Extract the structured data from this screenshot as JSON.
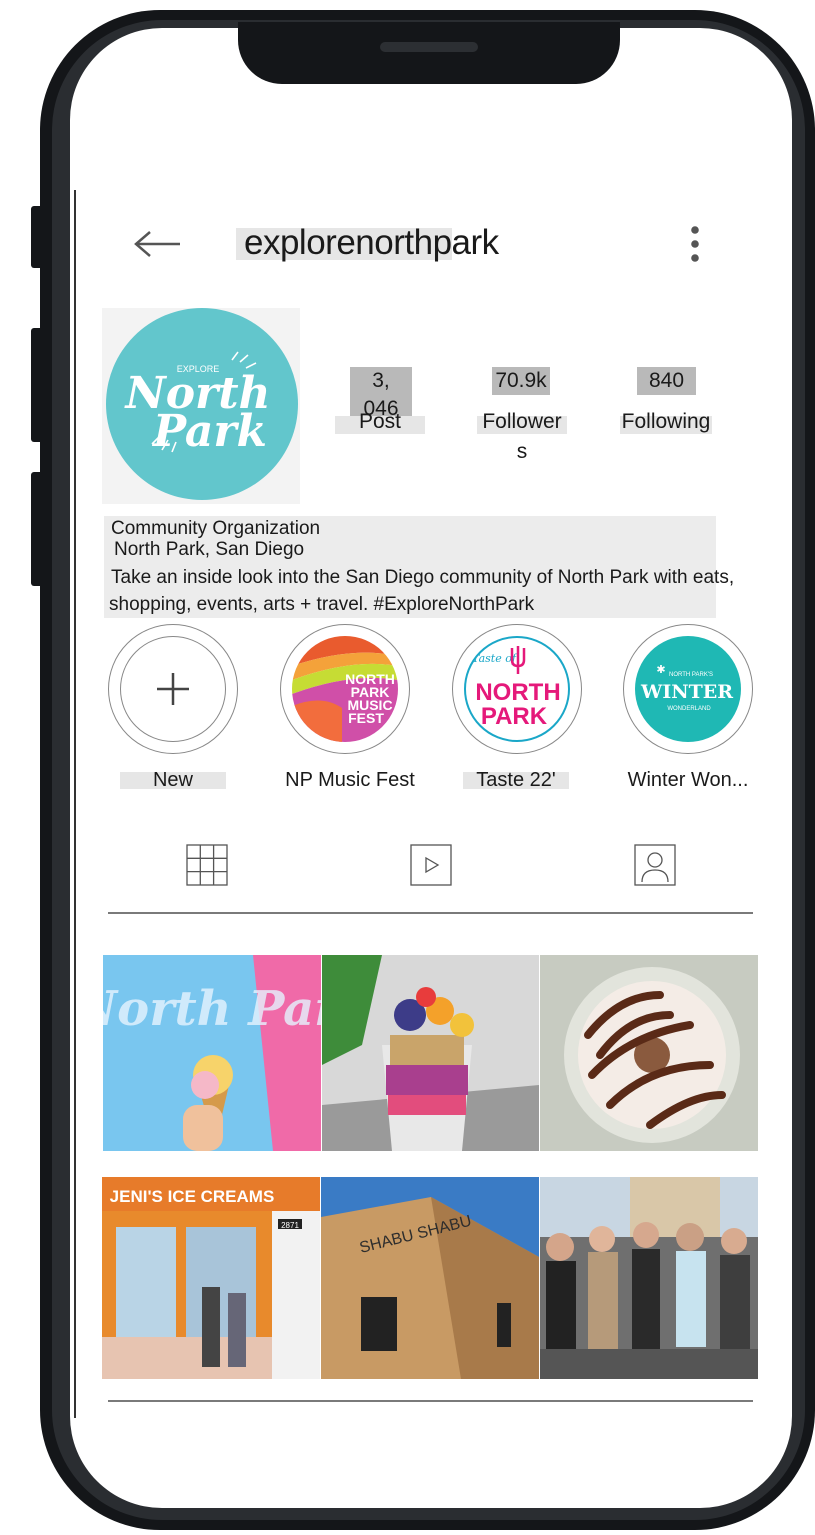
{
  "app": {
    "header": {
      "username": "explorenorthpark",
      "back_icon": "arrow-left-icon",
      "menu_icon": "more-vertical-icon"
    },
    "profile": {
      "avatar": {
        "small_text": "EXPLORE",
        "line1": "North",
        "line2": "Park",
        "color": "#62c6cc"
      },
      "stats": [
        {
          "value": "3, 046",
          "label": "Post"
        },
        {
          "value": "70.9k",
          "label_line1": "Follower",
          "label_line2": "s"
        },
        {
          "value": "840",
          "label": "Following"
        }
      ],
      "bio": {
        "category": "Community Organization",
        "location": "North Park, San Diego",
        "text_line1": "Take an inside look into the San Diego community of North Park with eats,",
        "text_line2": "shopping, events, arts + travel. #ExploreNorthPark"
      }
    },
    "highlights": [
      {
        "label": "New",
        "icon": "plus-icon"
      },
      {
        "label": "NP Music Fest",
        "cover_line1": "NORTH",
        "cover_line2": "PARK",
        "cover_line3": "MUSIC",
        "cover_line4": "FEST"
      },
      {
        "label": "Taste 22'",
        "cover_top": "Taste of",
        "cover_line1": "NORTH",
        "cover_line2": "PARK"
      },
      {
        "label": "Winter Won...",
        "cover_top": "NORTH PARK'S",
        "cover_line1": "WINTER",
        "cover_line2": "WONDERLAND"
      }
    ],
    "tabs": [
      {
        "name": "posts",
        "icon": "grid-icon"
      },
      {
        "name": "reels",
        "icon": "play-icon"
      },
      {
        "name": "tagged",
        "icon": "person-icon"
      }
    ],
    "grid": {
      "tiles": [
        {
          "subject": "ice-cream-cone",
          "sign_text": "North Park"
        },
        {
          "subject": "acai-bowl"
        },
        {
          "subject": "chocolate-drizzle-donut"
        },
        {
          "subject": "jenis-ice-cream-storefront",
          "sign_text": "JENI'S ICE CREAMS",
          "address": "2871"
        },
        {
          "subject": "shabu-restaurant",
          "sign_text": "SHABU SHABU"
        },
        {
          "subject": "street-festival-crowd"
        }
      ]
    },
    "colors": {
      "brand_teal": "#62c6cc",
      "phone_frame": "#141619",
      "divider": "#7a7a7a"
    }
  }
}
